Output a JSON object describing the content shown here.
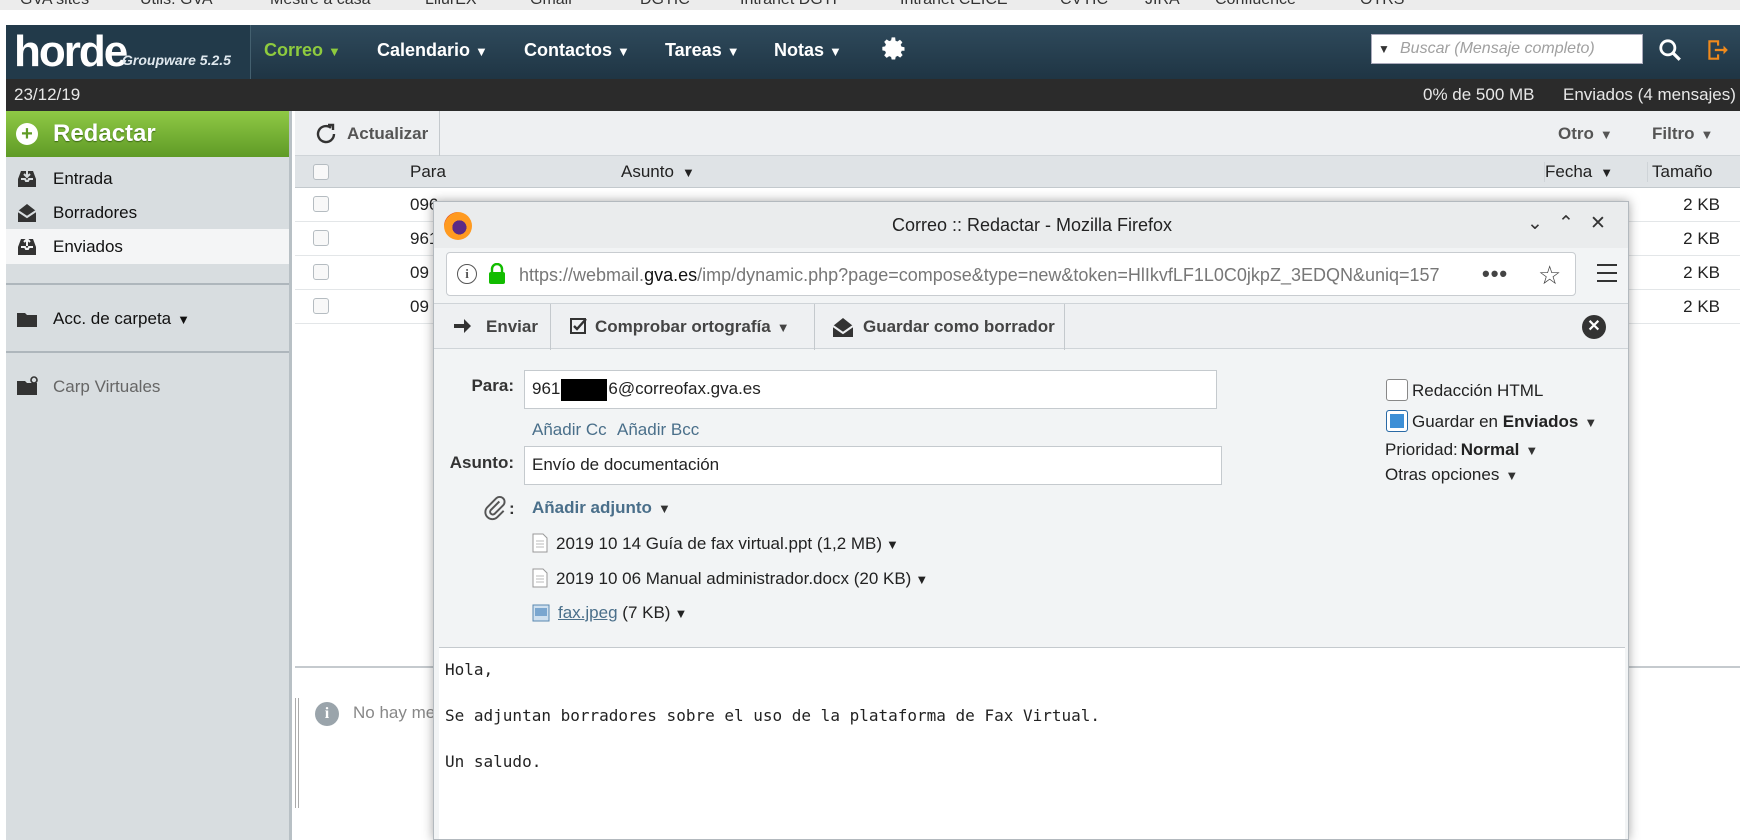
{
  "bookmarks": [
    "GVA sites",
    "Utils. GVA",
    "Mestre a casa",
    "LliurEX",
    "Gmail",
    "DGTIC",
    "Intranet DGTI",
    "Intranet CEICE",
    "CVTIC",
    "JIRA",
    "Confluence",
    "OTRS"
  ],
  "horde": {
    "logo": "horde",
    "product": "Groupware 5.2.5",
    "menu": {
      "correo": "Correo",
      "calendario": "Calendario",
      "contactos": "Contactos",
      "tareas": "Tareas",
      "notas": "Notas"
    },
    "search_placeholder": "Buscar (Mensaje completo)"
  },
  "status": {
    "date": "23/12/19",
    "quota": "0% de 500 MB",
    "folder_info": "Enviados (4 mensajes)"
  },
  "sidebar": {
    "compose": "Redactar",
    "folders": [
      {
        "label": "Entrada",
        "icon": "inbox-icon"
      },
      {
        "label": "Borradores",
        "icon": "drafts-icon"
      },
      {
        "label": "Enviados",
        "icon": "sent-icon"
      }
    ],
    "folder_actions": "Acc. de carpeta",
    "virtual_folders": "Carp Virtuales"
  },
  "mail_list": {
    "refresh": "Actualizar",
    "other": "Otro",
    "filter": "Filtro",
    "columns": {
      "to": "Para",
      "subject": "Asunto",
      "date": "Fecha",
      "size": "Tamaño"
    },
    "rows": [
      {
        "to": "096",
        "size": "2 KB"
      },
      {
        "to": "961",
        "size": "2 KB"
      },
      {
        "to": "09",
        "size": "2 KB"
      },
      {
        "to": "09",
        "size": "2 KB"
      }
    ],
    "preview_message": "No hay me"
  },
  "popup": {
    "window_title": "Correo :: Redactar - Mozilla Firefox",
    "url_prefix": "https://webmail.",
    "url_domain": "gva.es",
    "url_rest": "/imp/dynamic.php?page=compose&type=new&token=HlIkvfLF1L0C0jkpZ_3EDQN&uniq=157",
    "toolbar": {
      "send": "Enviar",
      "spellcheck": "Comprobar ortografía",
      "save_draft": "Guardar como borrador"
    },
    "to_label": "Para:",
    "to_prefix": "961",
    "to_suffix": "6@correofax.gva.es",
    "add_cc": "Añadir Cc",
    "add_bcc": "Añadir Bcc",
    "subject_label": "Asunto:",
    "subject_value": "Envío de documentación",
    "attach_label": "Añadir adjunto",
    "attachments": [
      {
        "name": "2019 10 14 Guía de fax virtual.ppt",
        "size": "(1,2 MB)"
      },
      {
        "name": "2019 10 06 Manual administrador.docx",
        "size": "(20 KB)"
      },
      {
        "name": "fax.jpeg",
        "size": "(7 KB)"
      }
    ],
    "options": {
      "html": "Redacción HTML",
      "save_in_prefix": "Guardar en",
      "save_in_folder": "Enviados",
      "priority_label": "Prioridad:",
      "priority_value": "Normal",
      "other": "Otras opciones"
    },
    "body": [
      "Hola,",
      "Se adjuntan borradores sobre el uso de la plataforma de Fax Virtual.",
      "Un saludo."
    ]
  },
  "colors": {
    "nav_bg": "#2f4a5c",
    "accent_green": "#8ecb3e",
    "status_bg": "#2b2b2b",
    "sidebar_bg": "#d8dde0",
    "link": "#4a6f8a"
  }
}
